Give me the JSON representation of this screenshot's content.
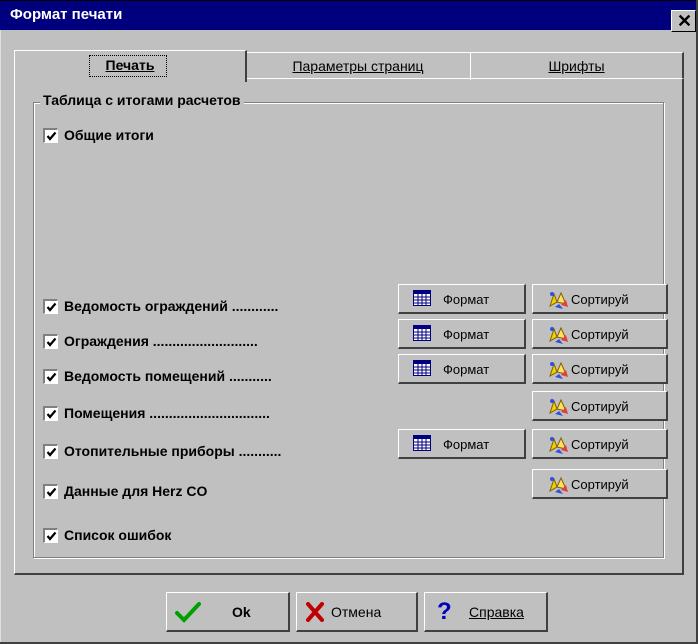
{
  "window": {
    "title": "Формат печати",
    "close_glyph": "✕"
  },
  "tabs": [
    {
      "label": "Печать",
      "active": true
    },
    {
      "label": "Параметры страниц",
      "active": false
    },
    {
      "label": "Шрифты",
      "active": false
    }
  ],
  "group": {
    "title": "Таблица с итогами расчетов"
  },
  "summary_checkbox": {
    "label": "Общие итоги",
    "checked": true
  },
  "rows": [
    {
      "label": "Ведомость ограждений ............",
      "checked": true,
      "format": "Формат",
      "sort": "Сортируй"
    },
    {
      "label": "Ограждения ...........................",
      "checked": true,
      "format": "Формат",
      "sort": "Сортируй"
    },
    {
      "label": "Ведомость помещений ...........",
      "checked": true,
      "format": "Формат",
      "sort": "Сортируй"
    },
    {
      "label": "Помещения ...............................",
      "checked": true,
      "sort": "Сортируй"
    },
    {
      "label": "Отопительные приборы ...........",
      "checked": true,
      "format": "Формат",
      "sort": "Сортируй"
    },
    {
      "label": "Данные для Herz CO",
      "checked": true,
      "sort": "Сортируй"
    },
    {
      "label": "Список ошибок",
      "checked": true
    }
  ],
  "footer": {
    "ok": "Ok",
    "cancel": "Отмена",
    "help": "Справка"
  },
  "icons": {
    "format": "table-icon",
    "sort": "hands-sort-icon",
    "ok": "checkmark-icon",
    "cancel": "x-icon",
    "help": "question-icon"
  },
  "colors": {
    "titlebar": "#00007f",
    "face": "#c0c0c0",
    "ok_green": "#00a000",
    "cancel_red": "#c00000",
    "help_blue": "#0000c0"
  }
}
